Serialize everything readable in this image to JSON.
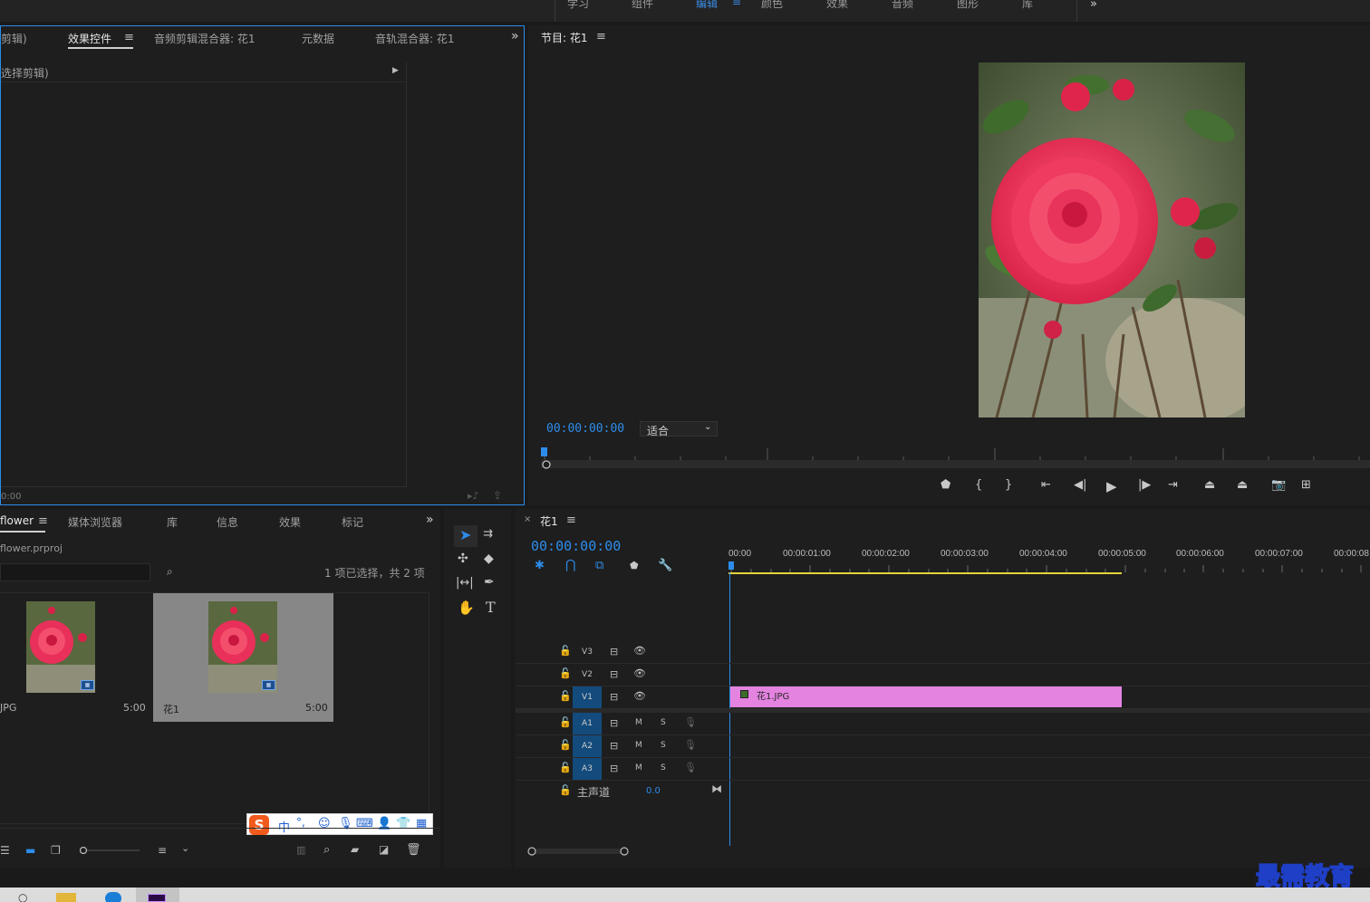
{
  "workspace_tabs": [
    "学习",
    "组件",
    "编辑",
    "颜色",
    "效果",
    "音频",
    "图形",
    "库"
  ],
  "workspace_active": "编辑",
  "effects_panel": {
    "tabs": [
      "剪辑)",
      "效果控件",
      "音频剪辑混合器: 花1",
      "元数据",
      "音轨混合器: 花1"
    ],
    "active_tab": "效果控件",
    "subheader": "选择剪辑)",
    "footer_time": "0:00"
  },
  "program_monitor": {
    "title": "节目: 花1",
    "timecode": "00:00:00:00",
    "zoom_fit": "适合"
  },
  "project_panel": {
    "tabs": [
      "flower",
      "媒体浏览器",
      "库",
      "信息",
      "效果",
      "标记"
    ],
    "active_tab": "flower",
    "project_file": "flower.prproj",
    "selection_info": "1 项已选择，共 2 项",
    "items": [
      {
        "name": "JPG",
        "duration": "5:00"
      },
      {
        "name": "花1",
        "duration": "5:00"
      }
    ]
  },
  "ime_toolbar": {
    "mode": "中",
    "punct": "°,"
  },
  "timeline": {
    "tab": "花1",
    "timecode": "00:00:00:00",
    "ruler": [
      "00:00",
      "00:00:01:00",
      "00:00:02:00",
      "00:00:03:00",
      "00:00:04:00",
      "00:00:05:00",
      "00:00:06:00",
      "00:00:07:00",
      "00:00:08"
    ],
    "video_tracks": [
      "V3",
      "V2",
      "V1"
    ],
    "audio_tracks": [
      "A1",
      "A2",
      "A3"
    ],
    "mute_label": "M",
    "solo_label": "S",
    "master_label": "主声道",
    "master_value": "0.0",
    "clip_name": "花1.JPG",
    "clip_color": "#e483e0"
  },
  "watermark": "最需教育",
  "colors": {
    "accent": "#2d8ceb",
    "panel": "#1e1e1e",
    "background": "#1a1a1a"
  }
}
